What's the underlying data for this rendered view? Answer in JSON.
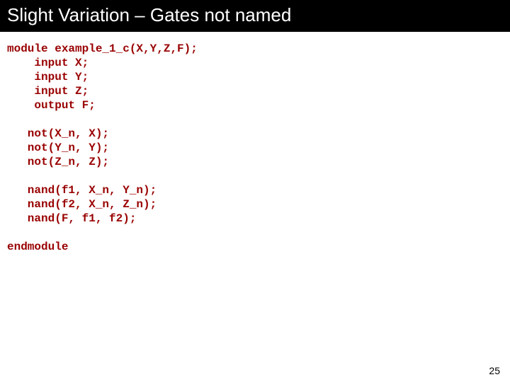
{
  "title": "Slight Variation – Gates not named",
  "code": "module example_1_c(X,Y,Z,F);\n    input X;\n    input Y;\n    input Z;\n    output F;\n\n   not(X_n, X);\n   not(Y_n, Y);\n   not(Z_n, Z);\n\n   nand(f1, X_n, Y_n);\n   nand(f2, X_n, Z_n);\n   nand(F, f1, f2);\n\nendmodule",
  "page_number": "25"
}
